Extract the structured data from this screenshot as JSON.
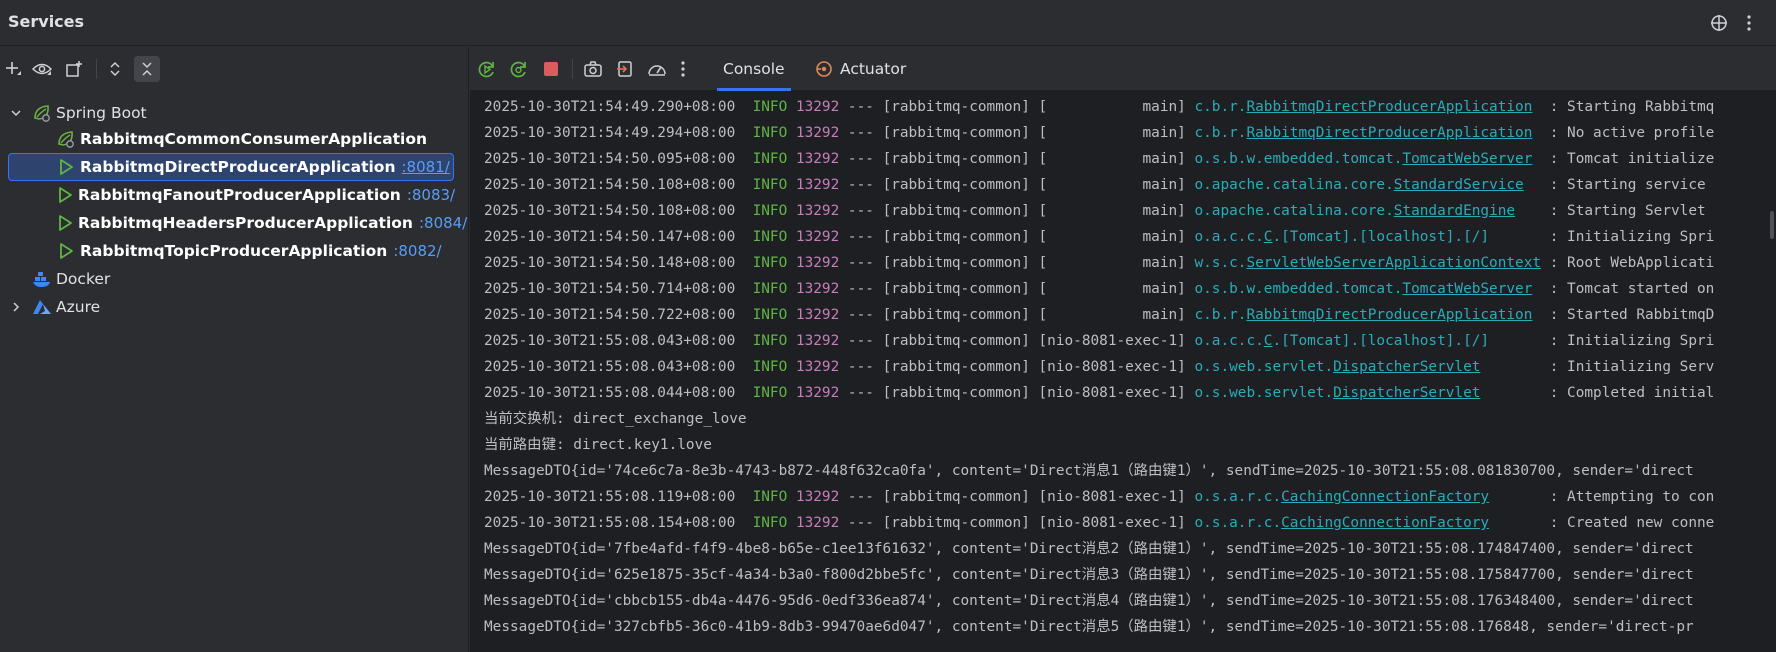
{
  "window": {
    "title": "Services"
  },
  "left_toolbar": {
    "buttons": [
      "add-icon",
      "eye-icon",
      "new-group-icon",
      "expand-all-icon",
      "collapse-all-icon"
    ]
  },
  "tree": {
    "spring_boot": {
      "label": "Spring Boot"
    },
    "apps": [
      {
        "name": "RabbitmqCommonConsumerApplication",
        "port": ""
      },
      {
        "name": "RabbitmqDirectProducerApplication",
        "port": ":8081/"
      },
      {
        "name": "RabbitmqFanoutProducerApplication",
        "port": ":8083/"
      },
      {
        "name": "RabbitmqHeadersProducerApplication",
        "port": ":8084/"
      },
      {
        "name": "RabbitmqTopicProducerApplication",
        "port": ":8082/"
      }
    ],
    "docker": {
      "label": "Docker"
    },
    "azure": {
      "label": "Azure"
    }
  },
  "tabs": {
    "console": "Console",
    "actuator": "Actuator"
  },
  "colors": {
    "info": "#5fb544",
    "pid": "#c77dbb",
    "logger": "#2aacb8",
    "selection": "#2e436e",
    "accent": "#3574f0"
  },
  "console": {
    "log_lines": [
      {
        "ts": "2025-10-30T21:54:49.290+08:00",
        "level": "INFO",
        "pid": "13292",
        "mid": " --- [rabbitmq-common] [           main] ",
        "logger_pre": "c.b.r.",
        "logger_u": "RabbitmqDirectProducerApplication",
        "logger_post": "",
        "msg": "  : Starting Rabbitmq"
      },
      {
        "ts": "2025-10-30T21:54:49.294+08:00",
        "level": "INFO",
        "pid": "13292",
        "mid": " --- [rabbitmq-common] [           main] ",
        "logger_pre": "c.b.r.",
        "logger_u": "RabbitmqDirectProducerApplication",
        "logger_post": "",
        "msg": "  : No active profile"
      },
      {
        "ts": "2025-10-30T21:54:50.095+08:00",
        "level": "INFO",
        "pid": "13292",
        "mid": " --- [rabbitmq-common] [           main] ",
        "logger_pre": "o.s.b.w.embedded.tomcat.",
        "logger_u": "TomcatWebServer",
        "logger_post": "",
        "msg": "  : Tomcat initialize"
      },
      {
        "ts": "2025-10-30T21:54:50.108+08:00",
        "level": "INFO",
        "pid": "13292",
        "mid": " --- [rabbitmq-common] [           main] ",
        "logger_pre": "o.apache.catalina.core.",
        "logger_u": "StandardService",
        "logger_post": "",
        "msg": "   : Starting service"
      },
      {
        "ts": "2025-10-30T21:54:50.108+08:00",
        "level": "INFO",
        "pid": "13292",
        "mid": " --- [rabbitmq-common] [           main] ",
        "logger_pre": "o.apache.catalina.core.",
        "logger_u": "StandardEngine",
        "logger_post": "",
        "msg": "    : Starting Servlet"
      },
      {
        "ts": "2025-10-30T21:54:50.147+08:00",
        "level": "INFO",
        "pid": "13292",
        "mid": " --- [rabbitmq-common] [           main] ",
        "logger_pre": "o.a.c.c.",
        "logger_u": "C",
        "logger_post": ".[Tomcat].[localhost].[/]",
        "msg": "       : Initializing Spri"
      },
      {
        "ts": "2025-10-30T21:54:50.148+08:00",
        "level": "INFO",
        "pid": "13292",
        "mid": " --- [rabbitmq-common] [           main] ",
        "logger_pre": "w.s.c.",
        "logger_u": "ServletWebServerApplicationContext",
        "logger_post": "",
        "msg": " : Root WebApplicati"
      },
      {
        "ts": "2025-10-30T21:54:50.714+08:00",
        "level": "INFO",
        "pid": "13292",
        "mid": " --- [rabbitmq-common] [           main] ",
        "logger_pre": "o.s.b.w.embedded.tomcat.",
        "logger_u": "TomcatWebServer",
        "logger_post": "",
        "msg": "  : Tomcat started on"
      },
      {
        "ts": "2025-10-30T21:54:50.722+08:00",
        "level": "INFO",
        "pid": "13292",
        "mid": " --- [rabbitmq-common] [           main] ",
        "logger_pre": "c.b.r.",
        "logger_u": "RabbitmqDirectProducerApplication",
        "logger_post": "",
        "msg": "  : Started RabbitmqD"
      },
      {
        "ts": "2025-10-30T21:55:08.043+08:00",
        "level": "INFO",
        "pid": "13292",
        "mid": " --- [rabbitmq-common] [nio-8081-exec-1] ",
        "logger_pre": "o.a.c.c.",
        "logger_u": "C",
        "logger_post": ".[Tomcat].[localhost].[/]",
        "msg": "       : Initializing Spri"
      },
      {
        "ts": "2025-10-30T21:55:08.043+08:00",
        "level": "INFO",
        "pid": "13292",
        "mid": " --- [rabbitmq-common] [nio-8081-exec-1] ",
        "logger_pre": "o.s.web.servlet.",
        "logger_u": "DispatcherServlet",
        "logger_post": "",
        "msg": "        : Initializing Serv"
      },
      {
        "ts": "2025-10-30T21:55:08.044+08:00",
        "level": "INFO",
        "pid": "13292",
        "mid": " --- [rabbitmq-common] [nio-8081-exec-1] ",
        "logger_pre": "o.s.web.servlet.",
        "logger_u": "DispatcherServlet",
        "logger_post": "",
        "msg": "        : Completed initial"
      }
    ],
    "plain_lines_a": [
      "当前交换机: direct_exchange_love",
      "当前路由键: direct.key1.love",
      "MessageDTO{id='74ce6c7a-8e3b-4743-b872-448f632ca0fa', content='Direct消息1（路由键1）', sendTime=2025-10-30T21:55:08.081830700, sender='direct"
    ],
    "log_lines_b": [
      {
        "ts": "2025-10-30T21:55:08.119+08:00",
        "level": "INFO",
        "pid": "13292",
        "mid": " --- [rabbitmq-common] [nio-8081-exec-1] ",
        "logger_pre": "o.s.a.r.c.",
        "logger_u": "CachingConnectionFactory",
        "logger_post": "",
        "msg": "       : Attempting to con"
      },
      {
        "ts": "2025-10-30T21:55:08.154+08:00",
        "level": "INFO",
        "pid": "13292",
        "mid": " --- [rabbitmq-common] [nio-8081-exec-1] ",
        "logger_pre": "o.s.a.r.c.",
        "logger_u": "CachingConnectionFactory",
        "logger_post": "",
        "msg": "       : Created new conne"
      }
    ],
    "plain_lines_b": [
      "MessageDTO{id='7fbe4afd-f4f9-4be8-b65e-c1ee13f61632', content='Direct消息2（路由键1）', sendTime=2025-10-30T21:55:08.174847400, sender='direct",
      "MessageDTO{id='625e1875-35cf-4a34-b3a0-f800d2bbe5fc', content='Direct消息3（路由键1）', sendTime=2025-10-30T21:55:08.175847700, sender='direct",
      "MessageDTO{id='cbbcb155-db4a-4476-95d6-0edf336ea874', content='Direct消息4（路由键1）', sendTime=2025-10-30T21:55:08.176348400, sender='direct",
      "MessageDTO{id='327cbfb5-36c0-41b9-8db3-99470ae6d047', content='Direct消息5（路由键1）', sendTime=2025-10-30T21:55:08.176848, sender='direct-pr"
    ]
  }
}
